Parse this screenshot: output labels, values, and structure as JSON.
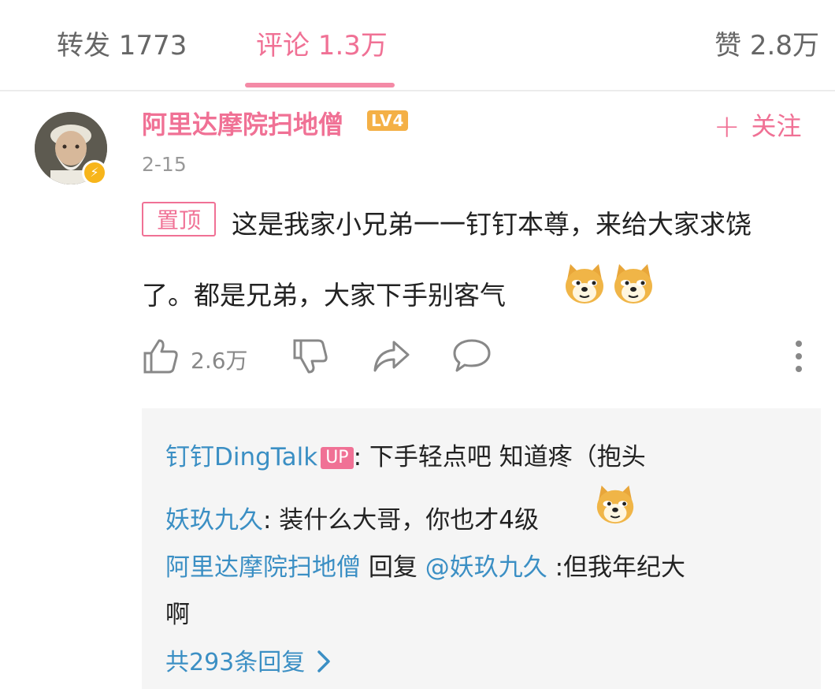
{
  "tabs": {
    "repost": "转发 1773",
    "comment": "评论 1.3万",
    "like": "赞 2.8万"
  },
  "comment": {
    "username": "阿里达摩院扫地僧",
    "level": "LV4",
    "date": "2-15",
    "follow_label": "关注",
    "pin_label": "置顶",
    "text_line1": "这是我家小兄弟一一钉钉本尊，来给大家求饶",
    "text_line2": "了。都是兄弟，大家下手别客气",
    "like_count": "2.6万",
    "emoji": "doge-emoji"
  },
  "replies": {
    "items": [
      {
        "user": "钉钉DingTalk",
        "badge": "UP",
        "sep": ":",
        "text": " 下手轻点吧 知道疼（抱头"
      },
      {
        "user": "妖玖九久",
        "sep": ":",
        "text": " 装什么大哥，你也才4级"
      },
      {
        "user": "阿里达摩院扫地僧",
        "reply_word": " 回复 ",
        "mention": "@妖玖九久",
        "sep": " :",
        "text": "但我年纪大",
        "text_cont": "啊"
      }
    ],
    "more_label": "共293条回复"
  },
  "colors": {
    "accent": "#f07195",
    "link": "#3b8fc4",
    "level": "#f4b046",
    "verified": "#f7b51b",
    "reply_bg": "#f5f5f5"
  },
  "icons": [
    "thumbs-up-icon",
    "thumbs-down-icon",
    "share-icon",
    "comment-icon",
    "more-vertical-icon",
    "chevron-right-icon",
    "plus-icon",
    "lightning-icon"
  ]
}
